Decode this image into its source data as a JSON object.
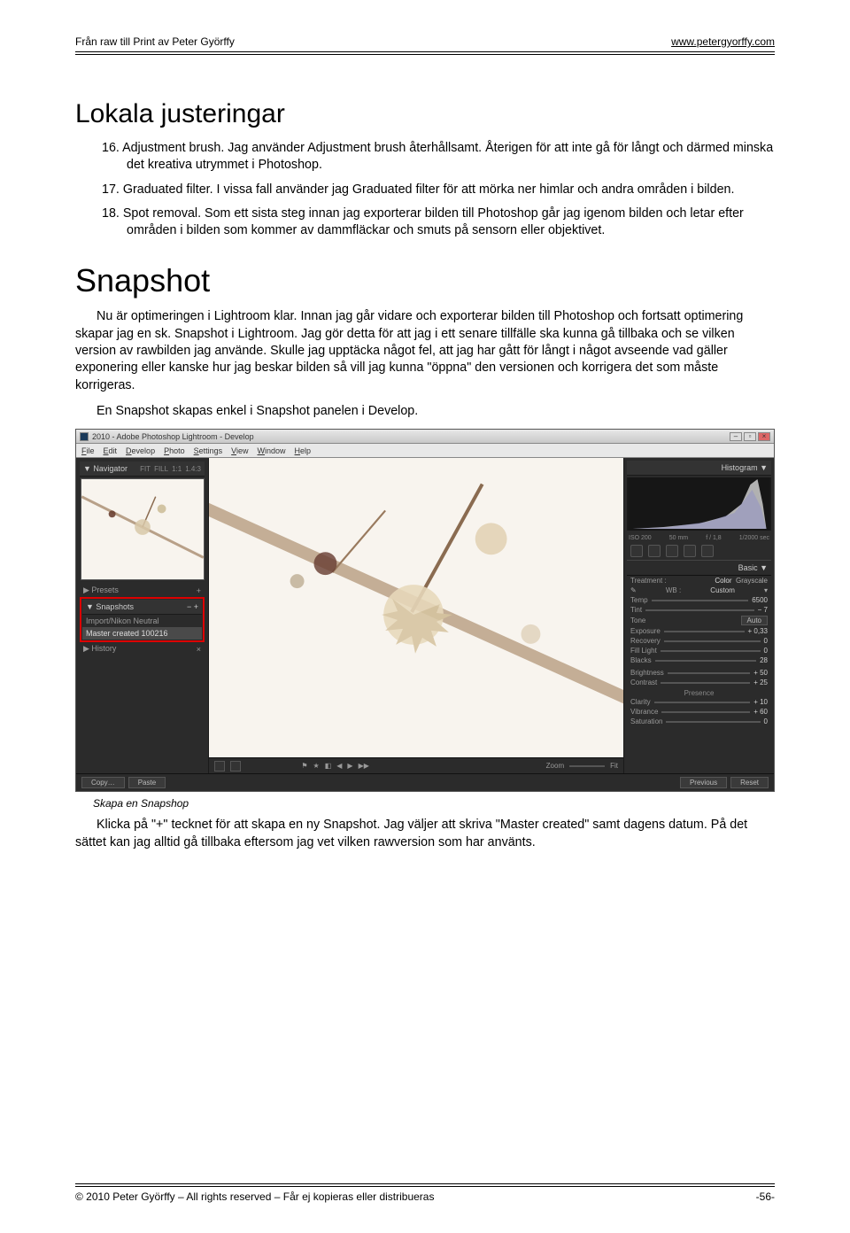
{
  "header": {
    "left": "Från raw till Print av Peter Györffy",
    "right": "www.petergyorffy.com"
  },
  "h1_1": "Lokala justeringar",
  "list": {
    "i16_num": "16.",
    "i16": "Adjustment brush. Jag använder Adjustment brush återhållsamt. Återigen för att inte gå för långt och därmed minska det kreativa utrymmet i Photoshop.",
    "i17_num": "17.",
    "i17": "Graduated filter. I vissa fall använder jag Graduated filter för att mörka ner himlar och andra områden i bilden.",
    "i18_num": "18.",
    "i18": "Spot removal. Som ett sista steg innan jag exporterar bilden till Photoshop går jag igenom bilden och letar efter områden i bilden som kommer av dammfläckar och smuts på sensorn eller objektivet."
  },
  "h1_2": "Snapshot",
  "p1": "Nu är optimeringen i Lightroom klar. Innan jag går vidare och exporterar bilden till Photoshop och fortsatt optimering skapar jag en sk. Snapshot i Lightroom. Jag gör detta för att jag i ett senare tillfälle ska kunna gå tillbaka och se vilken version av rawbilden jag använde. Skulle jag upptäcka något fel, att jag har gått för långt i något avseende vad gäller exponering eller kanske hur jag beskar bilden så vill jag kunna \"öppna\" den versionen och korrigera det som måste korrigeras.",
  "p2": "En Snapshot skapas enkel i Snapshot panelen i Develop.",
  "lr": {
    "title": "2010 - Adobe Photoshop Lightroom - Develop",
    "menu": [
      "File",
      "Edit",
      "Develop",
      "Photo",
      "Settings",
      "View",
      "Window",
      "Help"
    ],
    "nav": {
      "title": "Navigator",
      "zoom": [
        "FIT",
        "FILL",
        "1:1",
        "1.4:3"
      ]
    },
    "presets": "Presets",
    "snapshots_title": "Snapshots",
    "snapshot_items": [
      "Import/Nikon Neutral",
      "Master created 100216"
    ],
    "history": "History",
    "histogram": "Histogram",
    "histo_info": [
      "ISO 200",
      "50 mm",
      "f / 1,8",
      "1/2000 sec"
    ],
    "basic": "Basic",
    "treatment": {
      "label": "Treatment :",
      "opts": [
        "Color",
        "Grayscale"
      ]
    },
    "wb": {
      "label": "WB :",
      "value": "Custom"
    },
    "sliders": [
      {
        "label": "Temp",
        "value": "6500"
      },
      {
        "label": "Tint",
        "value": "− 7"
      }
    ],
    "tone_label": "Tone",
    "auto": "Auto",
    "tone": [
      {
        "label": "Exposure",
        "value": "+ 0,33"
      },
      {
        "label": "Recovery",
        "value": "0"
      },
      {
        "label": "Fill Light",
        "value": "0"
      },
      {
        "label": "Blacks",
        "value": "28"
      }
    ],
    "bc": [
      {
        "label": "Brightness",
        "value": "+ 50"
      },
      {
        "label": "Contrast",
        "value": "+ 25"
      }
    ],
    "presence_label": "Presence",
    "presence": [
      {
        "label": "Clarity",
        "value": "+ 10"
      },
      {
        "label": "Vibrance",
        "value": "+ 60"
      },
      {
        "label": "Saturation",
        "value": "0"
      }
    ],
    "bottom_left": [
      "Copy…",
      "Paste"
    ],
    "bottom_center": [
      "Zoom",
      "Fit"
    ],
    "bottom_right": [
      "Previous",
      "Reset"
    ]
  },
  "caption": "Skapa en Snapshop",
  "p3": "Klicka på \"+\" tecknet för att skapa en ny Snapshot. Jag väljer att skriva \"Master created\" samt dagens datum. På det sättet kan jag alltid gå tillbaka eftersom jag vet vilken rawversion som har använts.",
  "footer": {
    "left": "© 2010 Peter Györffy – All rights reserved – Får ej kopieras eller distribueras",
    "right": "-56-"
  }
}
